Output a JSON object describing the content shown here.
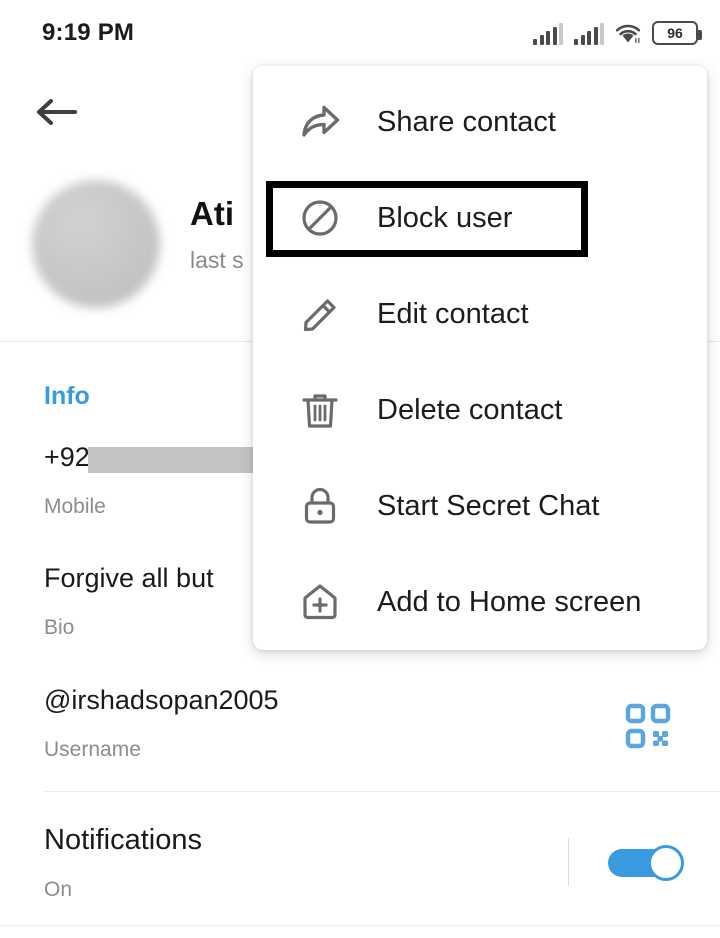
{
  "status_bar": {
    "time": "9:19 PM",
    "battery_level": "96",
    "icons": [
      "signal-bars-sim1",
      "signal-bars-sim2",
      "wifi-icon",
      "battery-icon"
    ]
  },
  "header": {
    "back_icon": "back-arrow-icon",
    "avatar": "contact-avatar",
    "name": "Ati",
    "status": "last s"
  },
  "info": {
    "section_title": "Info",
    "rows": [
      {
        "value": "+92",
        "label": "Mobile",
        "redacted": true
      },
      {
        "value": "Forgive all but",
        "label": "Bio",
        "redacted": false
      },
      {
        "value": "@irshadsopan2005",
        "label": "Username",
        "redacted": false
      }
    ],
    "qr_icon": "qr-code-icon"
  },
  "notifications": {
    "title": "Notifications",
    "state": "On",
    "toggle_on": true
  },
  "menu": {
    "items": [
      {
        "label": "Share contact",
        "icon": "share-icon",
        "highlighted": false
      },
      {
        "label": "Block user",
        "icon": "block-icon",
        "highlighted": true
      },
      {
        "label": "Edit contact",
        "icon": "pencil-icon",
        "highlighted": false
      },
      {
        "label": "Delete contact",
        "icon": "trash-icon",
        "highlighted": false
      },
      {
        "label": "Start Secret Chat",
        "icon": "lock-icon",
        "highlighted": false
      },
      {
        "label": "Add to Home screen",
        "icon": "home-plus-icon",
        "highlighted": false
      }
    ]
  },
  "colors": {
    "accent_blue": "#3a9ae0",
    "qr_blue": "#5aa6e0",
    "text_primary": "#1a1a1a",
    "text_secondary": "#8c8c8c",
    "background": "#ffffff",
    "highlight_border": "#000000"
  }
}
